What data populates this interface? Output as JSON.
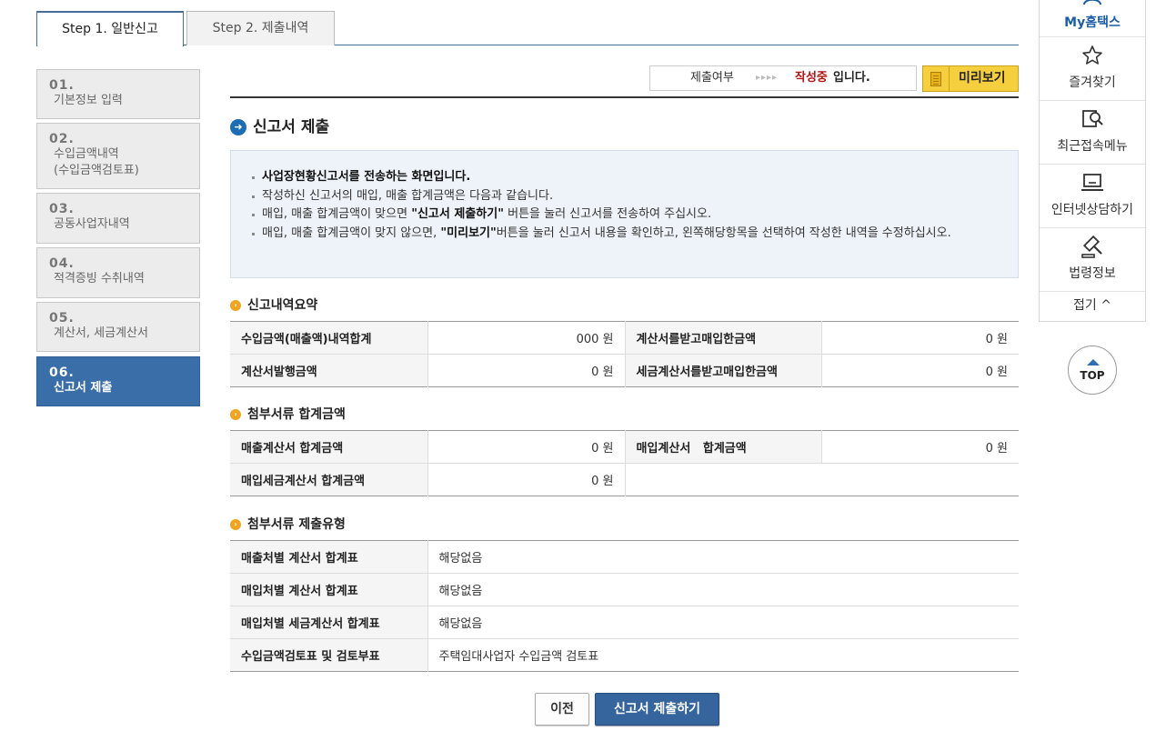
{
  "tabs": [
    {
      "label": "Step 1. 일반신고",
      "active": true
    },
    {
      "label": "Step 2. 제출내역",
      "active": false
    }
  ],
  "steps": [
    {
      "num": "01.",
      "label": "기본정보 입력"
    },
    {
      "num": "02.",
      "label": "수입금액내역\n(수입금액검토표)"
    },
    {
      "num": "03.",
      "label": "공동사업자내역"
    },
    {
      "num": "04.",
      "label": "적격증빙 수취내역"
    },
    {
      "num": "05.",
      "label": "계산서, 세금계산서"
    },
    {
      "num": "06.",
      "label": "신고서 제출"
    }
  ],
  "status": {
    "label": "제출여부",
    "arrows": "▸▸▸▸",
    "value": "작성중",
    "suffix": "입니다.",
    "preview_label": "미리보기"
  },
  "section_title": "신고서 제출",
  "info": {
    "line1": "사업장현황신고서를 전송하는 화면입니다.",
    "line2": "작성하신 신고서의 매입, 매출 합계금액은 다음과 같습니다.",
    "line3_pre": "매입, 매출 합계금액이 맞으면 ",
    "line3_bold": "\"신고서 제출하기\"",
    "line3_post": " 버튼을 눌러 신고서를 전송하여 주십시오.",
    "line4_pre": "매입, 매출 합계금액이 맞지 않으면, ",
    "line4_bold": "\"미리보기\"",
    "line4_post": "버튼을 눌러 신고서 내용을 확인하고, 왼쪽해당항목을 선택하여 작성한 내역을 수정하십시오."
  },
  "summary": {
    "title": "신고내역요약",
    "rows": [
      {
        "l1": "수입금액(매출액)내역합계",
        "v1_hidden": "",
        "v1": "000 원",
        "l2": "계산서를받고매입한금액",
        "v2": "0 원"
      },
      {
        "l1": "계산서발행금액",
        "v1": "0 원",
        "l2": "세금계산서를받고매입한금액",
        "v2": "0 원"
      }
    ]
  },
  "attach_sum": {
    "title": "첨부서류 합계금액",
    "rows": [
      {
        "l1": "매출계산서 합계금액",
        "v1": "0 원",
        "l2": "매입계산서   합계금액",
        "v2": "0 원"
      },
      {
        "l1": "매입세금계산서 합계금액",
        "v1": "0 원",
        "l2": "",
        "v2": ""
      }
    ]
  },
  "attach_type": {
    "title": "첨부서류 제출유형",
    "rows": [
      {
        "label": "매출처별 계산서 합계표",
        "value": "해당없음"
      },
      {
        "label": "매입처별 계산서 합계표",
        "value": "해당없음"
      },
      {
        "label": "매입처별 세금계산서 합계표",
        "value": "해당없음"
      },
      {
        "label": "수입금액검토표 및 검토부표",
        "value": "주택임대사업자 수입금액 검토표"
      }
    ]
  },
  "buttons": {
    "prev": "이전",
    "submit": "신고서 제출하기"
  },
  "quick": {
    "my": "My홈택스",
    "favorites": "즐겨찾기",
    "recent": "최근접속메뉴",
    "consult": "인터넷상담하기",
    "law": "법령정보",
    "fold": "접기 ^",
    "top": "TOP"
  }
}
